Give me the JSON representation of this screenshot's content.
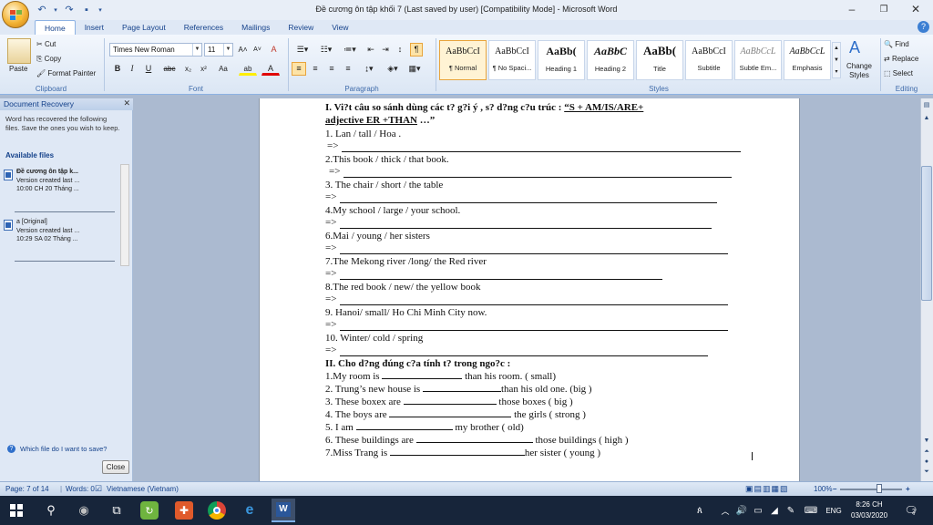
{
  "window": {
    "title": "Đề cương ôn tập khối 7 (Last saved by user) [Compatibility Mode] - Microsoft Word",
    "minimize": "–",
    "maximize": "❐",
    "close": "✕"
  },
  "qat": {
    "undo": "↶",
    "undo_dd": "▾",
    "redo": "↷",
    "save": "▪",
    "more": "▾"
  },
  "tabs": [
    {
      "label": "Home"
    },
    {
      "label": "Insert"
    },
    {
      "label": "Page Layout"
    },
    {
      "label": "References"
    },
    {
      "label": "Mailings"
    },
    {
      "label": "Review"
    },
    {
      "label": "View"
    }
  ],
  "ribbon": {
    "clipboard": {
      "label": "Clipboard",
      "paste": "Paste",
      "cut": "Cut",
      "copy": "Copy",
      "format_painter": "Format Painter"
    },
    "font": {
      "label": "Font",
      "name": "Times New Roman",
      "size": "11",
      "bold": "B",
      "italic": "I",
      "underline": "U",
      "strike": "abc",
      "sub": "x₂",
      "sup": "x²",
      "case": "Aa",
      "grow": "A˄",
      "shrink": "A˅",
      "clear": "A",
      "highlight": "ab",
      "color": "A"
    },
    "paragraph": {
      "label": "Paragraph"
    },
    "styles": {
      "label": "Styles",
      "items": [
        {
          "preview": "AaBbCcI",
          "name": "¶ Normal"
        },
        {
          "preview": "AaBbCcI",
          "name": "¶ No Spaci..."
        },
        {
          "preview": "AaBb(",
          "name": "Heading 1"
        },
        {
          "preview": "AaBbC",
          "name": "Heading 2"
        },
        {
          "preview": "AaBb(",
          "name": "Title"
        },
        {
          "preview": "AaBbCcI",
          "name": "Subtitle"
        },
        {
          "preview": "AaBbCcL",
          "name": "Subtle Em..."
        },
        {
          "preview": "AaBbCcL",
          "name": "Emphasis"
        }
      ],
      "change_styles": "Change Styles"
    },
    "editing": {
      "label": "Editing",
      "find": "Find",
      "replace": "Replace",
      "select": "Select"
    }
  },
  "pane": {
    "title": "Document Recovery",
    "close": "✕",
    "message": "Word has recovered the following files.  Save the ones you wish to keep.",
    "available": "Available files",
    "files": [
      {
        "name": "Đề cương ôn tập k...",
        "line1": "Version created last ...",
        "line2": "10:00 CH 20 Tháng ..."
      },
      {
        "name": "a  [Original]",
        "line1": "Version created last ...",
        "line2": "10:29 SA 02 Tháng ..."
      }
    ],
    "which_file": "Which file do I want to save?",
    "close_button": "Close"
  },
  "document": {
    "section1_title_a": "I. Vi?t câu so sánh dùng các t? g?i ý , s? d?ng c?u trúc : ",
    "section1_formula_a": "“S + AM/IS/ARE+",
    "section1_formula_b": "adjective  ER +THAN",
    "section1_formula_c": " …”",
    "arrow": "=>",
    "items1": [
      "1. Lan / tall / Hoa  .",
      "2.This book / thick / that book.",
      "3. The chair / short / the table",
      "4.My school / large / your school.",
      "6.Mai / young / her sisters",
      "7.The Mekong river /long/ the Red river",
      "8.The red book / new/ the yellow book",
      "9. Hanoi/ small/ Ho Chi Minh City now.",
      "10. Winter/ cold / spring"
    ],
    "section2_title": "II. Cho d?ng đúng c?a tính t?  trong ngo?c :",
    "items2": [
      {
        "pre": "1.My room is",
        "post": " than his room. ( small)"
      },
      {
        "pre": "2. Trung’s new house is",
        "post": "than  his old one. (big )"
      },
      {
        "pre": "3. These boxex are",
        "post": " those boxes ( big )"
      },
      {
        "pre": "4. The boys are",
        "post": " the girls ( strong )"
      },
      {
        "pre": "5. I am",
        "post": " my brother ( old)"
      },
      {
        "pre": "6. These buildings are",
        "post": " those buildings ( high )"
      },
      {
        "pre": "7.Miss Trang  is",
        "post": "her sister ( young )"
      }
    ]
  },
  "status": {
    "page": "Page: 7 of 14",
    "words": "Words: 0",
    "language": "Vietnamese (Vietnam)",
    "zoom": "100%",
    "zoom_minus": "–",
    "zoom_plus": "+"
  },
  "taskbar": {
    "time": "8:26 CH",
    "date": "03/03/2020",
    "lang": "ENG",
    "notif": "2"
  },
  "colors": {
    "accent": "#2b579a",
    "ribbon_bg": "#dbe6f4",
    "doc_bg": "#abbad0"
  }
}
